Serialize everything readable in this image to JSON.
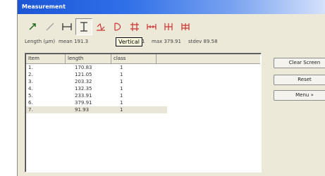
{
  "window": {
    "title": "Measurement"
  },
  "toolbar": {
    "tools": [
      {
        "name": "arrow-tool",
        "icon": "arrow-icon"
      },
      {
        "name": "line-tool",
        "icon": "line-icon"
      },
      {
        "name": "horizontal-tool",
        "icon": "horizontal-measure-icon"
      },
      {
        "name": "vertical-tool",
        "icon": "vertical-measure-icon"
      },
      {
        "name": "angle-tool",
        "icon": "angle-icon"
      },
      {
        "name": "curve-tool",
        "icon": "curve-icon"
      },
      {
        "name": "grid-tool",
        "icon": "grid-icon"
      },
      {
        "name": "span-tool",
        "icon": "span-icon"
      },
      {
        "name": "cross-tool",
        "icon": "cross-measure-icon"
      },
      {
        "name": "double-cross-tool",
        "icon": "double-cross-icon"
      }
    ],
    "tooltip": "Vertical"
  },
  "stats": {
    "label": "Length (µm)",
    "mean": "mean 191.3",
    "min": "7.01",
    "max": "max 379.91",
    "stdev": "stdev 89.58"
  },
  "table": {
    "columns": [
      "Item",
      "length",
      "class"
    ],
    "rows": [
      {
        "item": "1.",
        "length": "170.83",
        "class": "1"
      },
      {
        "item": "2.",
        "length": "121.05",
        "class": "1"
      },
      {
        "item": "3.",
        "length": "203.32",
        "class": "1"
      },
      {
        "item": "4.",
        "length": "132.35",
        "class": "1"
      },
      {
        "item": "5.",
        "length": "233.91",
        "class": "1"
      },
      {
        "item": "6.",
        "length": "379.91",
        "class": "1"
      },
      {
        "item": "7.",
        "length": "91.93",
        "class": "1"
      }
    ]
  },
  "buttons": {
    "clear": "Clear Screen",
    "reset": "Reset",
    "menu": "Menu »"
  }
}
